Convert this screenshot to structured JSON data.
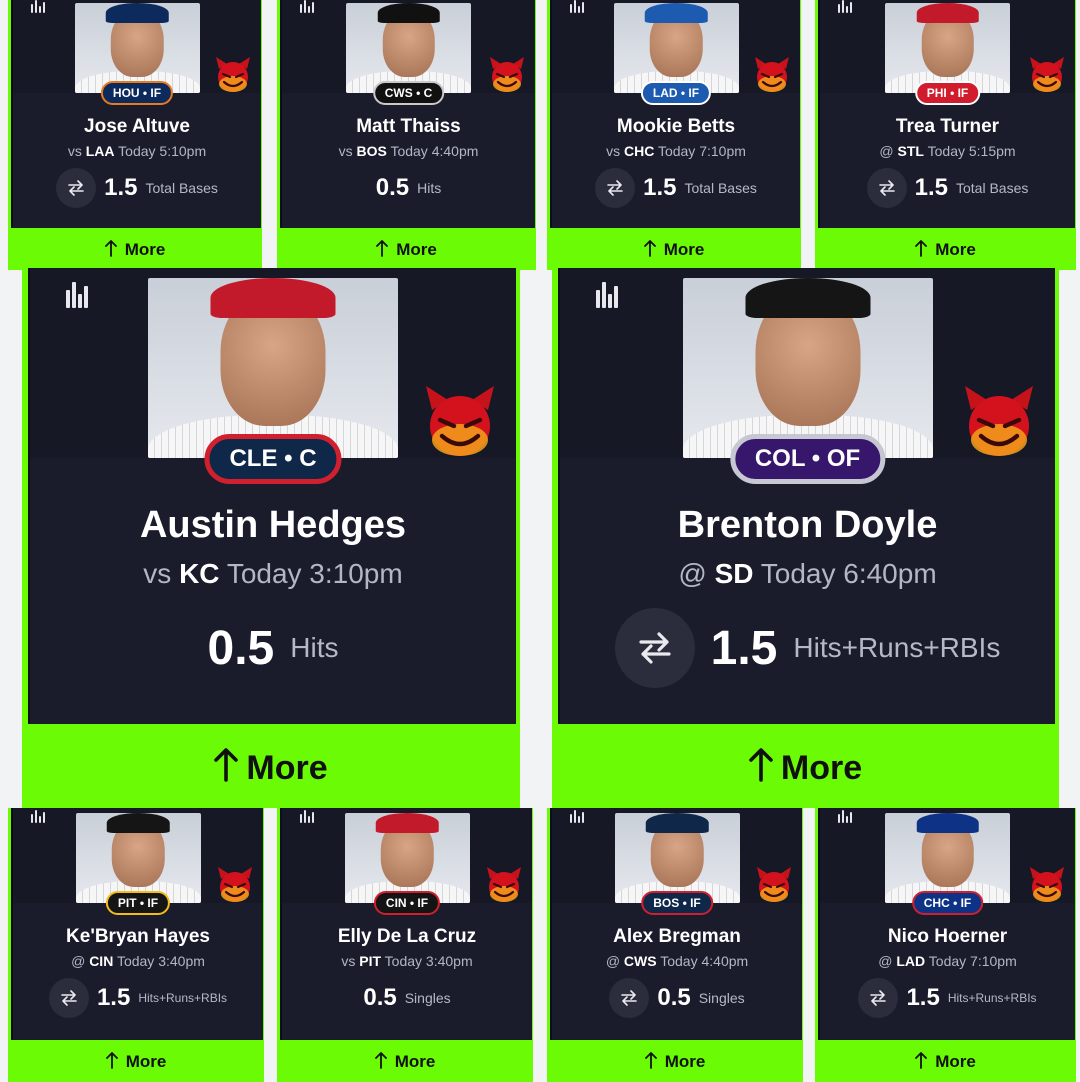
{
  "colors": {
    "accent": "#6bfc05",
    "card": "#1b1c2b",
    "text_muted": "#b3b6c7"
  },
  "icons": {
    "stats": "bar-chart-icon",
    "swap": "swap-arrows-icon",
    "more": "up-arrow-icon",
    "demon": "red-devil-emoji"
  },
  "cards": [
    {
      "name": "Jose Altuve",
      "team_pos": "HOU • IF",
      "badge_color": "#0d2a5c",
      "badge_border": "#ea7a1e",
      "cap": "#0d2a5c",
      "prefix": "vs",
      "opponent": "LAA",
      "time": "Today 5:10pm",
      "line": "1.5",
      "stat": "Total Bases",
      "swap": true,
      "more": "More"
    },
    {
      "name": "Matt Thaiss",
      "team_pos": "CWS • C",
      "badge_color": "#111111",
      "badge_border": "#c9c9c9",
      "cap": "#111111",
      "prefix": "vs",
      "opponent": "BOS",
      "time": "Today 4:40pm",
      "line": "0.5",
      "stat": "Hits",
      "swap": false,
      "more": "More"
    },
    {
      "name": "Mookie Betts",
      "team_pos": "LAD • IF",
      "badge_color": "#1d5bb0",
      "badge_border": "#ffffff",
      "cap": "#1d5bb0",
      "prefix": "vs",
      "opponent": "CHC",
      "time": "Today 7:10pm",
      "line": "1.5",
      "stat": "Total Bases",
      "swap": true,
      "more": "More"
    },
    {
      "name": "Trea Turner",
      "team_pos": "PHI • IF",
      "badge_color": "#d01c2c",
      "badge_border": "#ffffff",
      "cap": "#c21a2a",
      "prefix": "@",
      "opponent": "STL",
      "time": "Today 5:15pm",
      "line": "1.5",
      "stat": "Total Bases",
      "swap": true,
      "more": "More"
    },
    {
      "name": "Austin Hedges",
      "team_pos": "CLE • C",
      "badge_color": "#0f2748",
      "badge_border": "#d0202e",
      "cap": "#c21a2a",
      "prefix": "vs",
      "opponent": "KC",
      "time": "Today 3:10pm",
      "line": "0.5",
      "stat": "Hits",
      "swap": false,
      "more": "More"
    },
    {
      "name": "Brenton Doyle",
      "team_pos": "COL • OF",
      "badge_color": "#36176b",
      "badge_border": "#c7c7d3",
      "cap": "#151515",
      "prefix": "@",
      "opponent": "SD",
      "time": "Today 6:40pm",
      "line": "1.5",
      "stat": "Hits+Runs+RBIs",
      "swap": true,
      "more": "More"
    },
    {
      "name": "Ke'Bryan Hayes",
      "team_pos": "PIT • IF",
      "badge_color": "#151515",
      "badge_border": "#f4bd1c",
      "cap": "#151515",
      "prefix": "@",
      "opponent": "CIN",
      "time": "Today 3:40pm",
      "line": "1.5",
      "stat": "Hits+Runs+RBIs",
      "swap": true,
      "more": "More"
    },
    {
      "name": "Elly De La Cruz",
      "team_pos": "CIN • IF",
      "badge_color": "#141414",
      "badge_border": "#d0202e",
      "cap": "#c21a2a",
      "prefix": "vs",
      "opponent": "PIT",
      "time": "Today 3:40pm",
      "line": "0.5",
      "stat": "Singles",
      "swap": false,
      "more": "More"
    },
    {
      "name": "Alex Bregman",
      "team_pos": "BOS • IF",
      "badge_color": "#0f2748",
      "badge_border": "#d0202e",
      "cap": "#0f2748",
      "prefix": "@",
      "opponent": "CWS",
      "time": "Today 4:40pm",
      "line": "0.5",
      "stat": "Singles",
      "swap": true,
      "more": "More"
    },
    {
      "name": "Nico Hoerner",
      "team_pos": "CHC • IF",
      "badge_color": "#0e3386",
      "badge_border": "#d0202e",
      "cap": "#0e3386",
      "prefix": "@",
      "opponent": "LAD",
      "time": "Today 7:10pm",
      "line": "1.5",
      "stat": "Hits+Runs+RBIs",
      "swap": true,
      "more": "More"
    }
  ]
}
